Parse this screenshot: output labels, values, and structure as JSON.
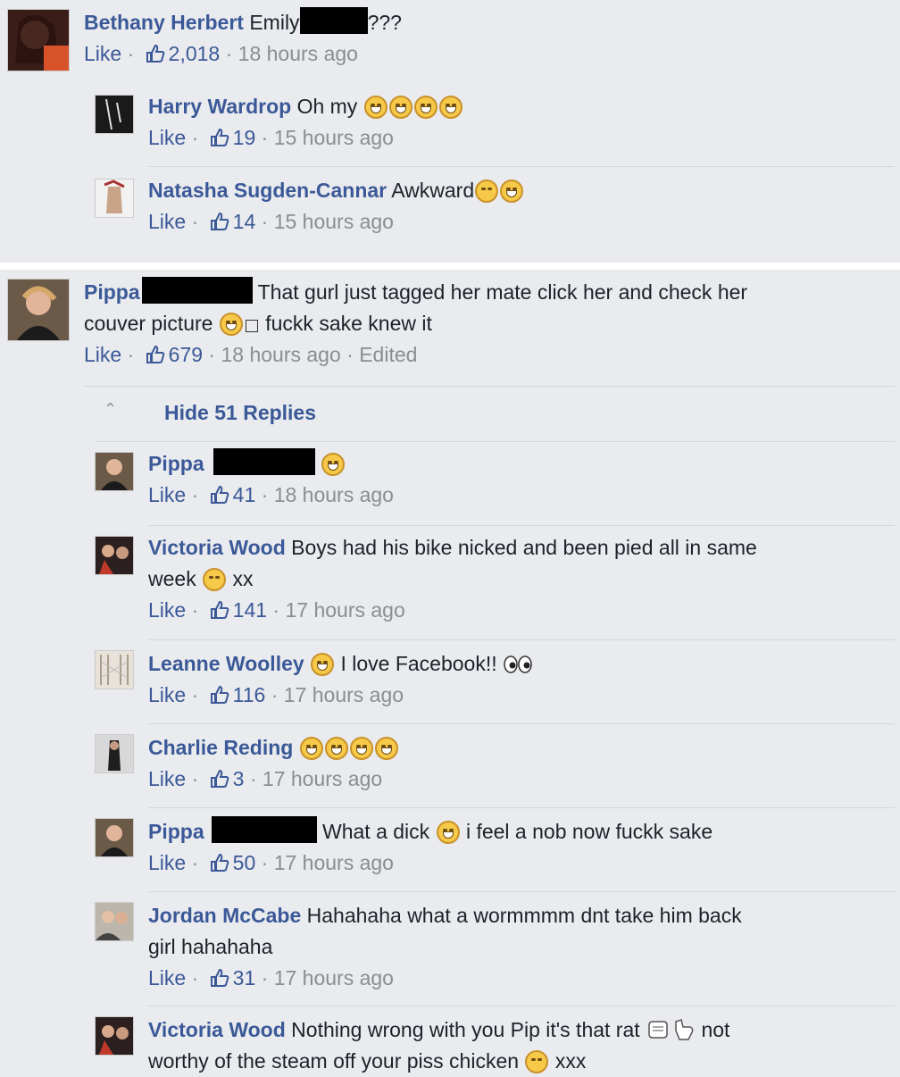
{
  "comments": [
    {
      "name": "Bethany Herbert",
      "text_before": "Emily",
      "text_after": "???",
      "like_label": "Like",
      "likes": "2,018",
      "time": "18 hours ago",
      "replies": [
        {
          "name": "Harry Wardrop",
          "text": "Oh my",
          "like_label": "Like",
          "likes": "19",
          "time": "15 hours ago"
        },
        {
          "name": "Natasha Sugden-Cannar",
          "text": "Awkward",
          "like_label": "Like",
          "likes": "14",
          "time": "15 hours ago"
        }
      ]
    },
    {
      "name": "Pippa",
      "text_line1": "That gurl just tagged her mate click her and check her",
      "text_line2a": "couver picture",
      "text_line2b": "fuckk sake knew it",
      "like_label": "Like",
      "likes": "679",
      "time": "18 hours ago",
      "edited": "Edited",
      "hide_replies_label": "Hide 51 Replies",
      "replies": [
        {
          "name": "Pippa",
          "text": "",
          "like_label": "Like",
          "likes": "41",
          "time": "18 hours ago"
        },
        {
          "name": "Victoria Wood",
          "text_line1": "Boys had his bike nicked and been pied all in same",
          "text_line2a": "week",
          "text_line2b": "xx",
          "like_label": "Like",
          "likes": "141",
          "time": "17 hours ago"
        },
        {
          "name": "Leanne Woolley",
          "text": "I love Facebook!!",
          "like_label": "Like",
          "likes": "116",
          "time": "17 hours ago"
        },
        {
          "name": "Charlie Reding",
          "text": "",
          "like_label": "Like",
          "likes": "3",
          "time": "17 hours ago"
        },
        {
          "name": "Pippa",
          "text_a": "What a dick",
          "text_b": "i feel a nob now fuckk sake",
          "like_label": "Like",
          "likes": "50",
          "time": "17 hours ago"
        },
        {
          "name": "Jordan McCabe",
          "text_line1": "Hahahaha what a wormmmm dnt take him back",
          "text_line2": "girl hahahaha",
          "like_label": "Like",
          "likes": "31",
          "time": "17 hours ago"
        },
        {
          "name": "Victoria Wood",
          "text_line1a": "Nothing wrong with you Pip it's that rat",
          "text_line1b": "not",
          "text_line2a": "worthy of the steam off your piss chicken",
          "text_line2b": "xxx"
        }
      ]
    }
  ],
  "colors": {
    "link": "#3b5998",
    "meta": "#8a8d91",
    "background": "#e9ebee"
  }
}
